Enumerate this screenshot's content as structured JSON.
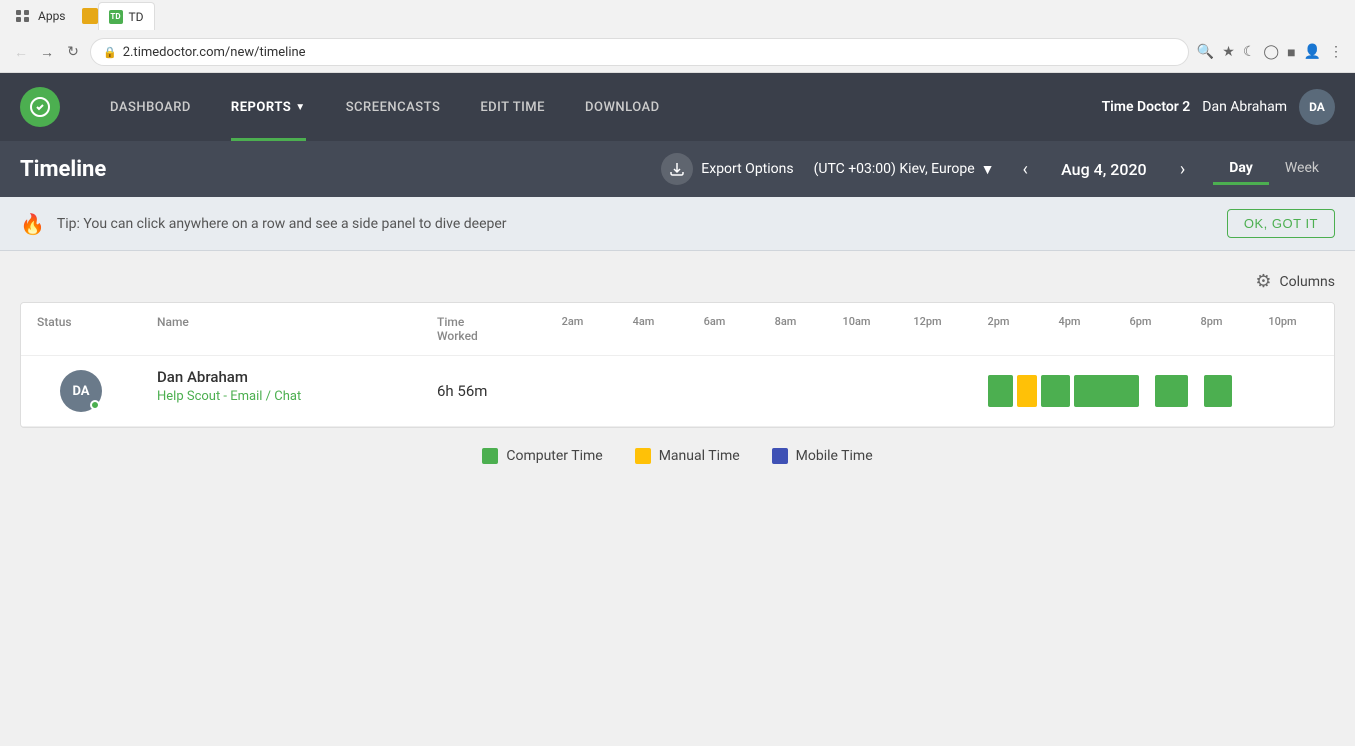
{
  "browser": {
    "url": "2.timedoctor.com/new/timeline",
    "tab_label": "TD",
    "apps_label": "Apps"
  },
  "header": {
    "nav": {
      "dashboard": "DASHBOARD",
      "reports": "REPORTS",
      "screencasts": "SCREENCASTS",
      "edit_time": "EDIT TIME",
      "download": "DOWNLOAD"
    },
    "app_name": "Time Doctor 2",
    "username": "Dan Abraham",
    "avatar_initials": "DA"
  },
  "subtitle": {
    "page_title": "Timeline",
    "export_label": "Export Options",
    "timezone": "(UTC +03:00) Kiev, Europe",
    "date": "Aug 4, 2020",
    "view_day": "Day",
    "view_week": "Week"
  },
  "tip": {
    "text": "Tip: You can click anywhere on a row and see a side panel to dive deeper",
    "ok_label": "OK, GOT IT"
  },
  "table": {
    "columns_label": "Columns",
    "headers": {
      "status": "Status",
      "name": "Name",
      "time_worked": "Time Worked"
    },
    "time_labels": [
      "2am",
      "4am",
      "6am",
      "8am",
      "10am",
      "12pm",
      "2pm",
      "4pm",
      "6pm",
      "8pm",
      "10pm"
    ],
    "rows": [
      {
        "avatar_initials": "DA",
        "name": "Dan Abraham",
        "task": "Help Scout - Email / Chat",
        "time_worked": "6h 56m",
        "online": true
      }
    ]
  },
  "legend": {
    "computer_time": "Computer Time",
    "manual_time": "Manual Time",
    "mobile_time": "Mobile Time"
  },
  "colors": {
    "nav_active_underline": "#4CAF50",
    "green": "#4CAF50",
    "orange": "#FFC107",
    "blue": "#3F51B5"
  }
}
